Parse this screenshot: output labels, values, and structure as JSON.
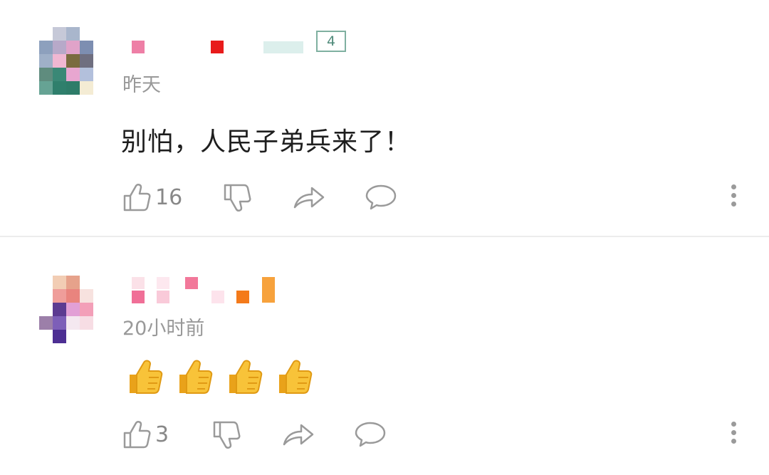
{
  "comments": [
    {
      "time": "昨天",
      "level": "4",
      "content": "别怕，人民子弟兵来了！",
      "likes": "16",
      "has_text_body": true
    },
    {
      "time": "20小时前",
      "content_emoji": [
        "👍",
        "👍",
        "👍",
        "👍"
      ],
      "likes": "3",
      "has_text_body": false
    }
  ],
  "icons": {
    "like": "thumbs-up-outline-icon",
    "dislike": "thumbs-down-outline-icon",
    "share": "share-arrow-icon",
    "reply": "speech-bubble-icon",
    "more": "vertical-dots-icon"
  },
  "colors": {
    "icon_gray": "#9a9a9a",
    "time_gray": "#999999",
    "badge_green": "#4f8a7a",
    "divider": "#ececec"
  }
}
